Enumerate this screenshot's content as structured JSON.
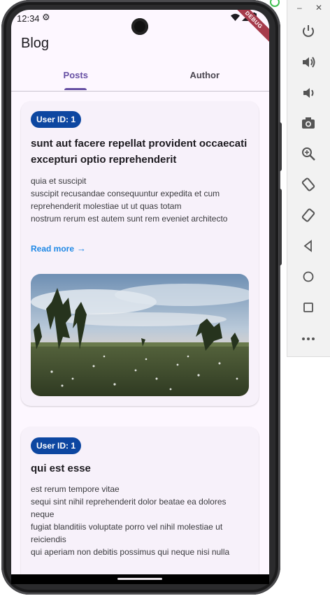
{
  "status_bar": {
    "time": "12:34",
    "debug_label": "DEBUG"
  },
  "app_bar": {
    "title": "Blog"
  },
  "tabs": [
    {
      "label": "Posts",
      "selected": true
    },
    {
      "label": "Author",
      "selected": false
    }
  ],
  "posts": [
    {
      "badge": "User ID: 1",
      "title": "sunt aut facere repellat provident occaecati excepturi optio reprehenderit",
      "body": "quia et suscipit\nsuscipit recusandae consequuntur expedita et cum reprehenderit molestiae ut ut quas totam\nnostrum rerum est autem sunt rem eveniet architecto",
      "read_more": "Read more",
      "image": "landscape-photo"
    },
    {
      "badge": "User ID: 1",
      "title": "qui est esse",
      "body": "est rerum tempore vitae\nsequi sint nihil reprehenderit dolor beatae ea dolores neque\nfugiat blanditiis voluptate porro vel nihil molestiae ut reiciendis\nqui aperiam non debitis possimus qui neque nisi nulla"
    }
  ],
  "emulator_toolbar": {
    "window_minimize": "–",
    "window_close": "✕",
    "buttons": [
      "power-icon",
      "volume-up-icon",
      "volume-down-icon",
      "camera-icon",
      "zoom-icon",
      "rotate-left-icon",
      "rotate-right-icon",
      "back-icon",
      "home-icon",
      "overview-icon",
      "more-icon"
    ]
  },
  "colors": {
    "primary": "#6750a4",
    "badge": "#0d47a1",
    "link": "#1e88e5",
    "background": "#fdf7ff",
    "card": "#f7f1fa"
  }
}
